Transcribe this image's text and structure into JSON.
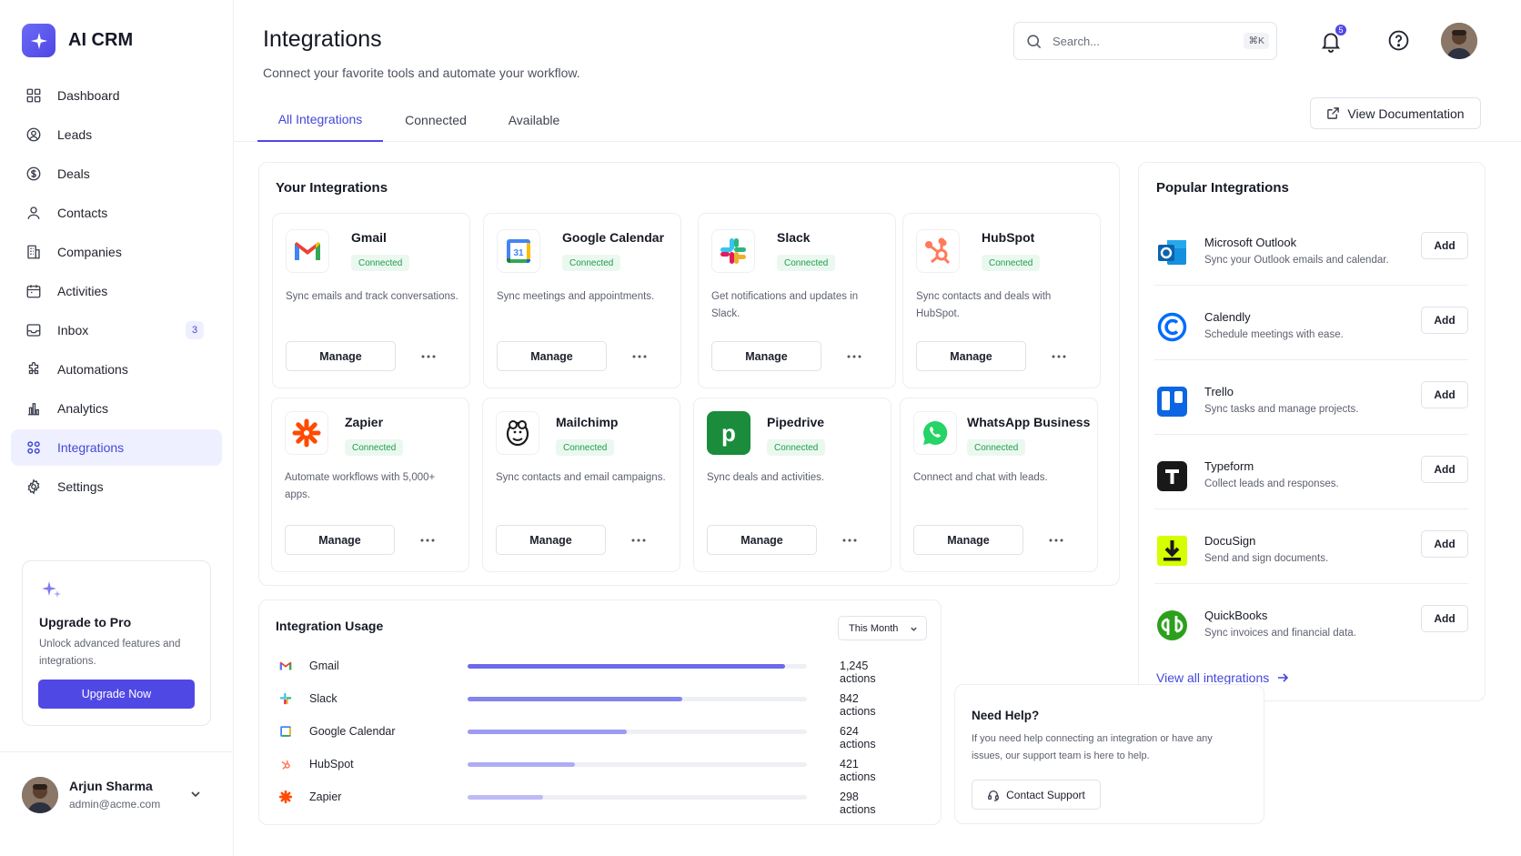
{
  "app": {
    "name": "AI CRM"
  },
  "colors": {
    "accent": "#5048e5",
    "connected_bg": "#ebf8ef",
    "connected_text": "#1f9d4e"
  },
  "nav": [
    {
      "label": "Dashboard",
      "icon": "dashboard-icon"
    },
    {
      "label": "Leads",
      "icon": "user-circle-icon"
    },
    {
      "label": "Deals",
      "icon": "dollar-icon"
    },
    {
      "label": "Contacts",
      "icon": "user-icon"
    },
    {
      "label": "Companies",
      "icon": "building-icon"
    },
    {
      "label": "Activities",
      "icon": "calendar-icon"
    },
    {
      "label": "Inbox",
      "icon": "inbox-icon",
      "badge": "3"
    },
    {
      "label": "Automations",
      "icon": "puzzle-icon"
    },
    {
      "label": "Analytics",
      "icon": "bar-chart-icon"
    },
    {
      "label": "Integrations",
      "icon": "integrations-icon",
      "active": true
    },
    {
      "label": "Settings",
      "icon": "gear-icon"
    }
  ],
  "upgrade": {
    "title": "Upgrade to Pro",
    "text": "Unlock advanced features and integrations.",
    "button": "Upgrade Now"
  },
  "user": {
    "name": "Arjun Sharma",
    "email": "admin@acme.com"
  },
  "header": {
    "title": "Integrations",
    "subtitle": "Connect your favorite tools and automate your workflow.",
    "search_placeholder": "Search...",
    "search_shortcut": "⌘K",
    "notifications": "5"
  },
  "tabs": [
    {
      "label": "All Integrations",
      "active": true
    },
    {
      "label": "Connected"
    },
    {
      "label": "Available"
    }
  ],
  "docs_button": "View Documentation",
  "your_integrations": {
    "title": "Your Integrations",
    "manage_label": "Manage",
    "items": [
      {
        "name": "Gmail",
        "status": "Connected",
        "desc": "Sync emails and track conversations."
      },
      {
        "name": "Google Calendar",
        "status": "Connected",
        "desc": "Sync meetings and appointments."
      },
      {
        "name": "Slack",
        "status": "Connected",
        "desc": "Get notifications and updates in Slack."
      },
      {
        "name": "HubSpot",
        "status": "Connected",
        "desc": "Sync contacts and deals with HubSpot."
      },
      {
        "name": "Zapier",
        "status": "Connected",
        "desc": "Automate workflows with 5,000+ apps."
      },
      {
        "name": "Mailchimp",
        "status": "Connected",
        "desc": "Sync contacts and email campaigns."
      },
      {
        "name": "Pipedrive",
        "status": "Connected",
        "desc": "Sync deals and activities."
      },
      {
        "name": "WhatsApp Business",
        "status": "Connected",
        "desc": "Connect and chat with leads."
      }
    ]
  },
  "usage": {
    "title": "Integration Usage",
    "period": "This Month",
    "rows": [
      {
        "name": "Gmail",
        "count": "1,245 actions",
        "value": 1245
      },
      {
        "name": "Slack",
        "count": "842 actions",
        "value": 842
      },
      {
        "name": "Google Calendar",
        "count": "624 actions",
        "value": 624
      },
      {
        "name": "HubSpot",
        "count": "421 actions",
        "value": 421
      },
      {
        "name": "Zapier",
        "count": "298 actions",
        "value": 298
      }
    ]
  },
  "popular": {
    "title": "Popular Integrations",
    "add_label": "Add",
    "view_all": "View all integrations",
    "items": [
      {
        "name": "Microsoft Outlook",
        "desc": "Sync your Outlook emails and calendar."
      },
      {
        "name": "Calendly",
        "desc": "Schedule meetings with ease."
      },
      {
        "name": "Trello",
        "desc": "Sync tasks and manage projects."
      },
      {
        "name": "Typeform",
        "desc": "Collect leads and responses."
      },
      {
        "name": "DocuSign",
        "desc": "Send and sign documents."
      },
      {
        "name": "QuickBooks",
        "desc": "Sync invoices and financial data."
      }
    ]
  },
  "help": {
    "title": "Need Help?",
    "text": "If you need help connecting an integration or have any issues, our support team is here to help.",
    "button": "Contact Support"
  }
}
